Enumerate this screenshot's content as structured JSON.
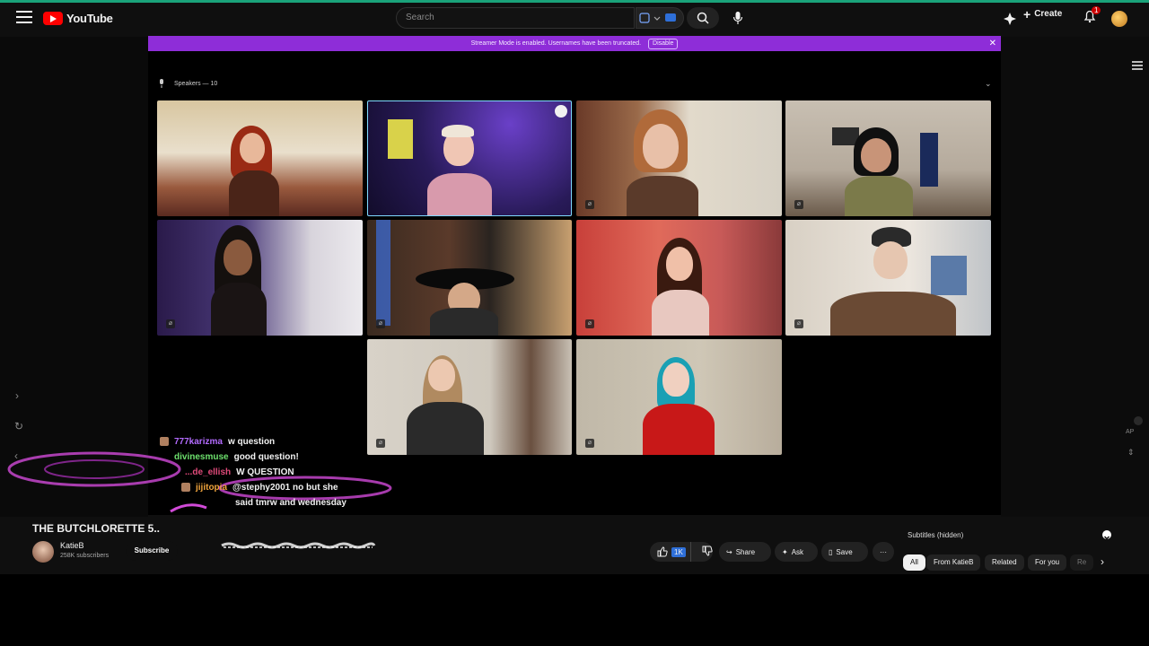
{
  "header": {
    "logo_text": "YouTube",
    "search_placeholder": "Search",
    "create_label": "Create",
    "notification_count": "1"
  },
  "banner": {
    "text": "Streamer Mode is enabled. Usernames have been truncated.",
    "disable_label": "Disable"
  },
  "stream": {
    "speakers_label": "Speakers — 10"
  },
  "chat": {
    "messages": [
      {
        "user": "777karizma",
        "user_color": "#b36bff",
        "text": "w question"
      },
      {
        "user": "divinesmuse",
        "user_color": "#6de06d",
        "text": "good question!"
      },
      {
        "user": "...de_ellish",
        "user_color": "#e04a7a",
        "text": "W QUESTION"
      },
      {
        "user": "jijitopia",
        "user_color": "#f0a43c",
        "text": "@stephy2001 no but she"
      },
      {
        "user": "",
        "user_color": "#ffffff",
        "text": "said tmrw and wednesday"
      }
    ]
  },
  "video": {
    "title": "THE BUTCHLORETTE 5..",
    "channel_name": "KatieB",
    "subscribers": "258K subscribers",
    "subscribe_label": "Subscribe"
  },
  "actions": {
    "like_count": "1K",
    "share_label": "Share",
    "ask_label": "Ask",
    "save_label": "Save"
  },
  "sidebar": {
    "subtitles_label": "Subtitles (hidden)",
    "chips": [
      "All",
      "From KatieB",
      "Related",
      "For you",
      "Re"
    ],
    "ap_label": "AP"
  },
  "colors": {
    "banner": "#8e2dd8",
    "accent_line": "#1aa37a",
    "like_highlight": "#2e6fd8"
  }
}
